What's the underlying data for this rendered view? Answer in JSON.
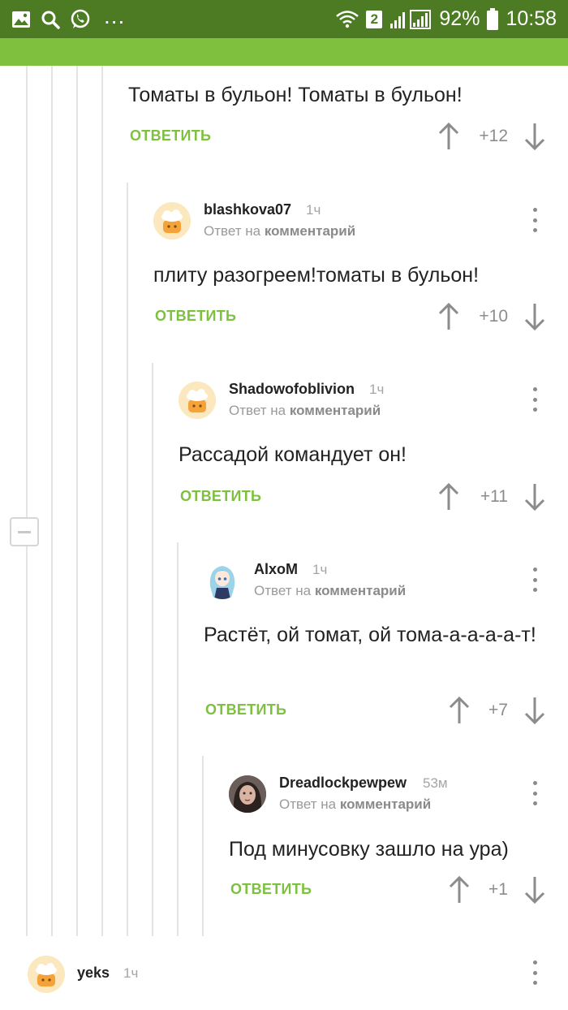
{
  "status_bar": {
    "battery": "92%",
    "time": "10:58",
    "sim_badge": "2",
    "more": "...",
    "icons": [
      "image-icon",
      "search-icon",
      "whatsapp-icon",
      "wifi-icon",
      "signal-icon",
      "battery-icon"
    ]
  },
  "colors": {
    "status_bar": "#4d7b23",
    "top_bar": "#7fc03f",
    "accent": "#7ec040"
  },
  "comments": [
    {
      "text": "Томаты в бульон! Томаты в бульон!",
      "reply_label": "ОТВЕТИТЬ",
      "score": "+12"
    },
    {
      "username": "blashkova07",
      "time": "1ч",
      "reply_prefix": "Ответ на",
      "reply_target": "комментарий",
      "text": "плиту разогреем!томаты в бульон!",
      "reply_label": "ОТВЕТИТЬ",
      "score": "+10",
      "avatar": "default-avatar-icon"
    },
    {
      "username": "Shadowofoblivion",
      "time": "1ч",
      "reply_prefix": "Ответ на",
      "reply_target": "комментарий",
      "text": "Рассадой командует он!",
      "reply_label": "ОТВЕТИТЬ",
      "score": "+11",
      "avatar": "default-avatar-icon"
    },
    {
      "username": "AlxoM",
      "time": "1ч",
      "reply_prefix": "Ответ на",
      "reply_target": "комментарий",
      "text": "Растёт, ой томат, ой тома-а-а-а-а-т!",
      "reply_label": "ОТВЕТИТЬ",
      "score": "+7",
      "avatar": "anime-avatar"
    },
    {
      "username": "Dreadlockpewpew",
      "time": "53м",
      "reply_prefix": "Ответ на",
      "reply_target": "комментарий",
      "text": "Под минусовку зашло на ура)",
      "reply_label": "ОТВЕТИТЬ",
      "score": "+1",
      "avatar": "photo-avatar"
    },
    {
      "username": "yeks",
      "time": "1ч",
      "avatar": "default-avatar-icon"
    }
  ]
}
